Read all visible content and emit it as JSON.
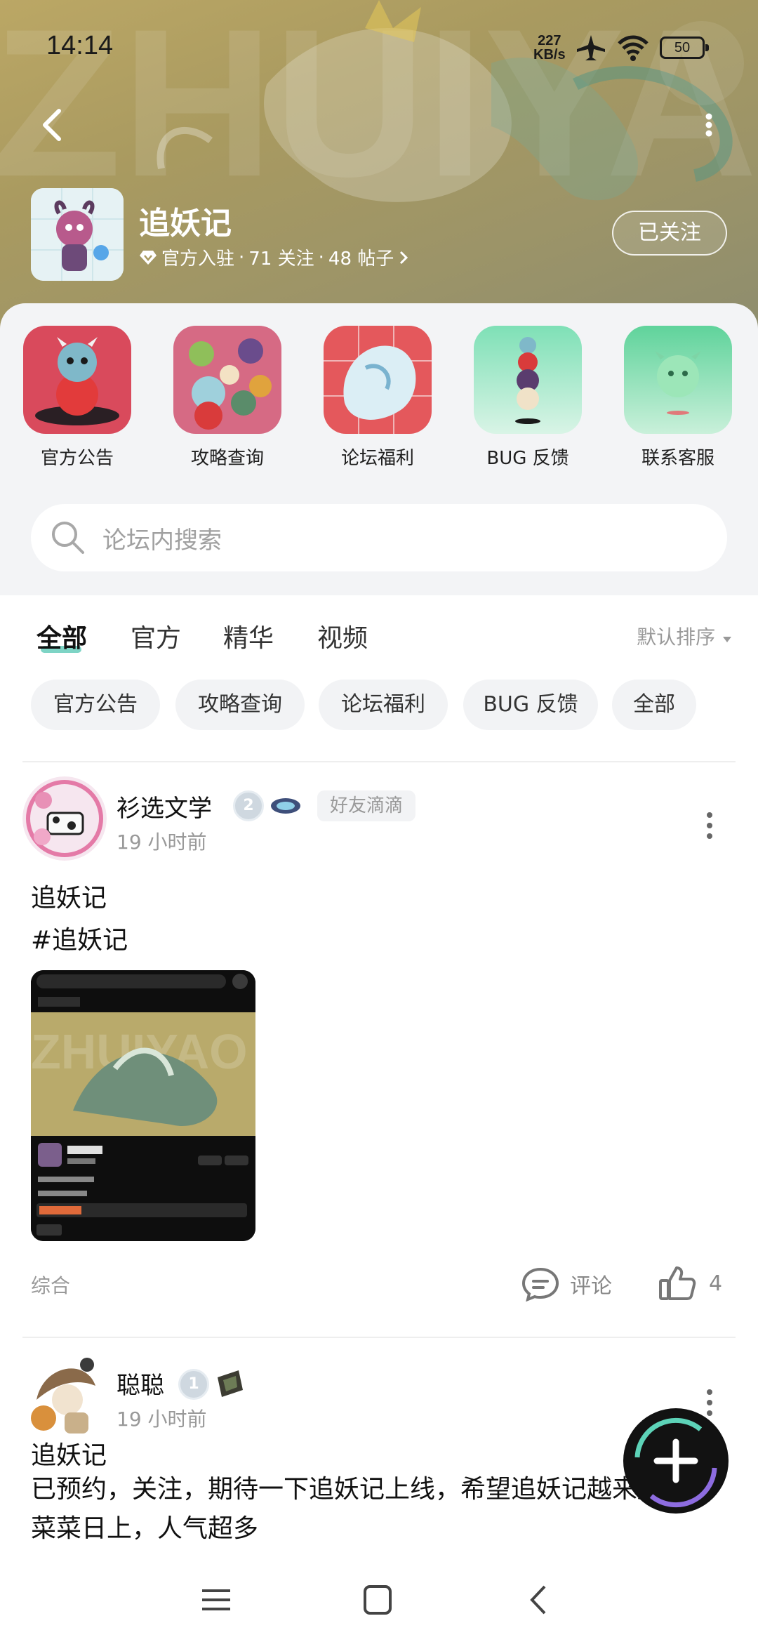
{
  "status_bar": {
    "time": "14:14",
    "net_speed_value": "227",
    "net_speed_unit": "KB/s",
    "battery": "50"
  },
  "forum": {
    "name": "追妖记",
    "official": "官方入驻",
    "followers": "71 关注",
    "posts": "48 帖子",
    "follow_label": "已关注"
  },
  "quick_menu": [
    {
      "label": "官方公告",
      "icon": "official-notice-icon"
    },
    {
      "label": "攻略查询",
      "icon": "guide-icon"
    },
    {
      "label": "论坛福利",
      "icon": "welfare-icon"
    },
    {
      "label": "BUG 反馈",
      "icon": "bug-feedback-icon"
    },
    {
      "label": "联系客服",
      "icon": "customer-service-icon"
    }
  ],
  "search": {
    "placeholder": "论坛内搜索"
  },
  "tabs": [
    {
      "label": "全部",
      "active": true
    },
    {
      "label": "官方",
      "active": false
    },
    {
      "label": "精华",
      "active": false
    },
    {
      "label": "视频",
      "active": false
    }
  ],
  "sort_label": "默认排序",
  "chips": [
    "官方公告",
    "攻略查询",
    "论坛福利",
    "BUG 反馈",
    "全部"
  ],
  "posts": [
    {
      "user": "衫选文学",
      "level": "2",
      "tag": "好友滴滴",
      "time": "19 小时前",
      "title": "追妖记",
      "body": "#追妖记",
      "category": "综合",
      "comment_label": "评论",
      "likes": "4"
    },
    {
      "user": "聪聪",
      "level": "1",
      "time": "19 小时前",
      "title": "追妖记",
      "body": "已预约，关注，期待一下追妖记上线，希望追妖记越来越好，菜菜日上，人气超多"
    }
  ],
  "colors": {
    "accent": "#7ed4c5",
    "banner": "#a99a60"
  }
}
